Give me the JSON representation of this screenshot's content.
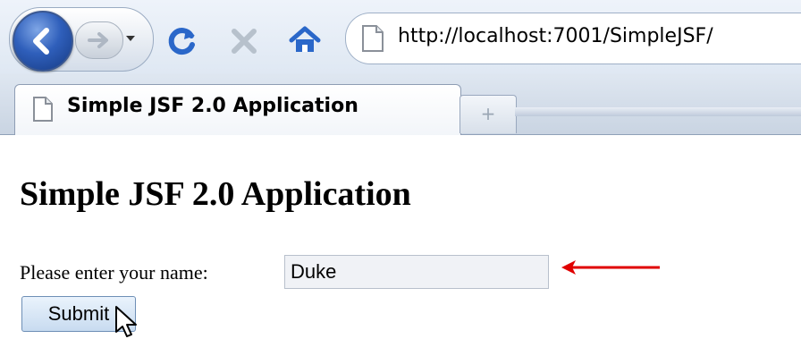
{
  "browser": {
    "url": "http://localhost:7001/SimpleJSF/",
    "icons": {
      "back": "back-arrow-icon",
      "forward": "forward-arrow-icon",
      "dropdown": "chevron-down-icon",
      "reload": "reload-icon",
      "stop": "stop-icon",
      "home": "home-icon",
      "page": "page-icon"
    },
    "colors": {
      "reload": "#2a67c9",
      "stop": "#b7c1cc",
      "home": "#2a67c9"
    }
  },
  "tabs": {
    "active_title": "Simple JSF 2.0 Application",
    "new_tab_label": "+"
  },
  "page": {
    "title": "Simple JSF 2.0 Application",
    "name_label": "Please enter your name:",
    "name_value": "Duke",
    "submit_label": "Submit",
    "annotation_arrow_color": "#e00000"
  }
}
